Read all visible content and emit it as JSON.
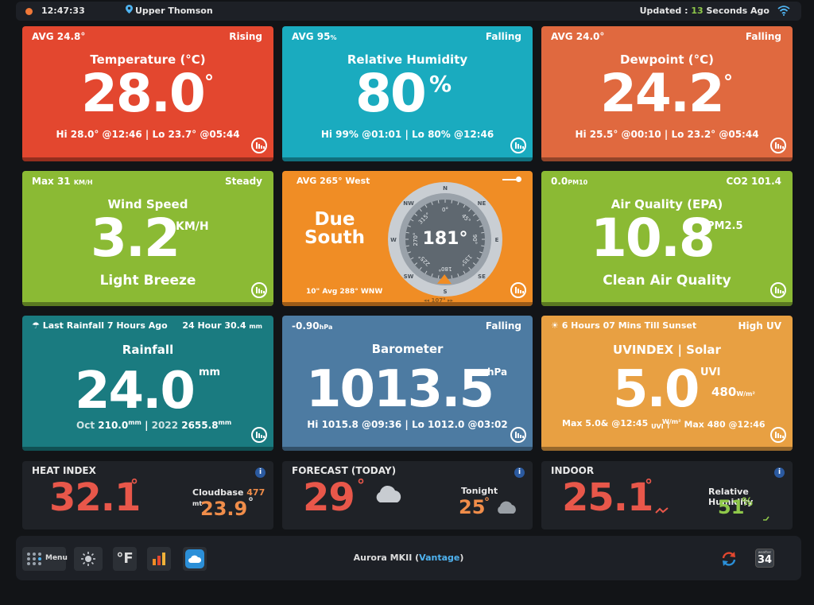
{
  "topbar": {
    "time": "12:47:33",
    "location": "Upper Thomson",
    "updated_prefix": "Updated : ",
    "updated_value": "13",
    "updated_suffix": " Seconds Ago"
  },
  "temperature": {
    "avg": "AVG 24.8°",
    "trend": "Rising",
    "title": "Temperature (°C)",
    "value": "28.0",
    "unit": "°",
    "foot": "Hi 28.0° @12:46 | Lo 23.7° @05:44"
  },
  "humidity": {
    "avg": "AVG 95",
    "avg_unit": "%",
    "trend": "Falling",
    "title": "Relative Humidity",
    "value": "80",
    "unit": "%",
    "foot": "Hi 99% @01:01 | Lo 80% @12:46"
  },
  "dewpoint": {
    "avg": "AVG 24.0°",
    "trend": "Falling",
    "title": "Dewpoint (°C)",
    "value": "24.2",
    "unit": "°",
    "foot": "Hi 25.5° @00:10 | Lo 23.2° @05:44"
  },
  "wind": {
    "max": "Max 31",
    "max_unit": "KM/H",
    "trend": "Steady",
    "title": "Wind Speed",
    "value": "3.2",
    "unit": "KM/H",
    "desc": "Light Breeze"
  },
  "compass": {
    "avg": "AVG 265° West",
    "direction_line1": "Due",
    "direction_line2": "South",
    "bearing": "181°",
    "bearing_deg": 181,
    "avg10": "10\" Avg 288° WNW",
    "bottom": "◂◂ 107° ▸▸",
    "cardinals": [
      "N",
      "NE",
      "E",
      "SE",
      "S",
      "SW",
      "W",
      "NW"
    ],
    "degrees": [
      "0°",
      "45°",
      "90°",
      "135°",
      "180°",
      "225°",
      "270°",
      "315°"
    ]
  },
  "airquality": {
    "pm10": "0.0",
    "pm10_unit": "PM10",
    "co2": "CO2 101.4",
    "title": "Air Quality (EPA)",
    "value": "10.8",
    "unit": "PM2.5",
    "desc": "Clean Air Quality"
  },
  "rainfall": {
    "last": "Last Rainfall 7 Hours Ago",
    "day": "24 Hour 30.4",
    "day_unit": "mm",
    "title": "Rainfall",
    "value": "24.0",
    "unit": "mm",
    "month_label": "Oct",
    "month_value": "210.0",
    "month_unit": "mm",
    "year_label": "2022",
    "year_value": "2655.8",
    "year_unit": "mm"
  },
  "barometer": {
    "change": "-0.90",
    "change_unit": "hPa",
    "trend": "Falling",
    "title": "Barometer",
    "value": "1013.5",
    "unit": "hPa",
    "foot": "Hi 1015.8 @09:36 | Lo 1012.0 @03:02"
  },
  "uv": {
    "sunset": "6 Hours 07 Mins Till Sunset",
    "level": "High UV",
    "title": "UVINDEX | Solar",
    "value": "5.0",
    "unit": "UVI",
    "solar": "480",
    "solar_unit": "W/m²",
    "foot_left": "Max 5.0& @12:45",
    "foot_left_unit": "UVI",
    "foot_right": "Max 480 @12:46",
    "foot_right_unit": "W/m²"
  },
  "heatindex": {
    "title": "HEAT INDEX",
    "value": "32.1",
    "unit": "°",
    "cloudbase_label": "Cloudbase",
    "cloudbase_value": "477",
    "cloudbase_unit": "mt",
    "second": "23.9",
    "second_unit": "°"
  },
  "forecast": {
    "title": "FORECAST (TODAY)",
    "value": "29",
    "unit": "°",
    "tonight_label": "Tonight",
    "tonight_value": "25",
    "tonight_unit": "°"
  },
  "indoor": {
    "title": "INDOOR",
    "value": "25.1",
    "unit": "°",
    "rh_label": "Relative Humidity",
    "rh_value": "51",
    "rh_unit": "%"
  },
  "bottombar": {
    "menu_label": "Menu",
    "unit_label": "°F",
    "station": "Aurora MKII (",
    "station_model": "Vantage",
    "station_end": ")",
    "badge_top": "weather",
    "badge_num": "34"
  },
  "info_glyph": "i",
  "colors": {
    "temperature": "#e3472f",
    "humidity": "#1aabbf",
    "dewpoint": "#e0693f",
    "wind": "#8bba34",
    "compass": "#f08d25",
    "airquality": "#8bba34",
    "rainfall": "#1a7b80",
    "barometer": "#4d7ba2",
    "uv": "#e8a042",
    "hot_red": "#e8574a",
    "warm_orange": "#f08d4a",
    "green": "#8fc84a"
  }
}
